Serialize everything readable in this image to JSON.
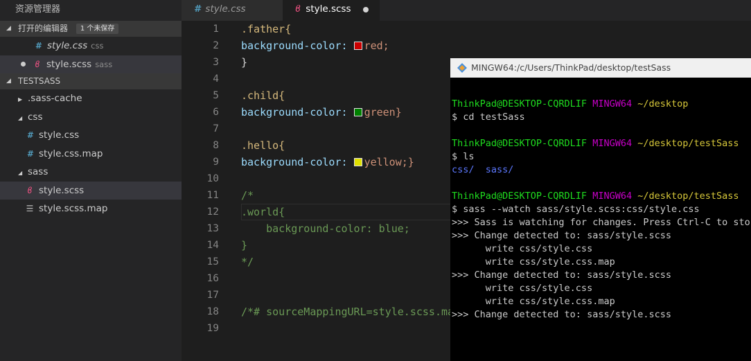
{
  "sidebar": {
    "header": "资源管理器",
    "open_editors": {
      "label": "打开的编辑器",
      "badge": "1 个未保存",
      "items": [
        {
          "name": "style.css",
          "hint": "css",
          "icon": "css-hash-icon"
        },
        {
          "name": "style.scss",
          "hint": "sass",
          "icon": "sass-icon"
        }
      ]
    },
    "project": {
      "label": "TESTSASS",
      "items": [
        {
          "name": ".sass-cache"
        },
        {
          "name": "css"
        },
        {
          "name": "style.css"
        },
        {
          "name": "style.css.map"
        },
        {
          "name": "sass"
        },
        {
          "name": "style.scss"
        },
        {
          "name": "style.scss.map"
        }
      ]
    }
  },
  "tabs": [
    {
      "label": "style.css"
    },
    {
      "label": "style.scss"
    }
  ],
  "editor": {
    "line_numbers": [
      "1",
      "2",
      "3",
      "4",
      "5",
      "6",
      "7",
      "8",
      "9",
      "10",
      "11",
      "12",
      "13",
      "14",
      "15",
      "16",
      "17",
      "18",
      "19"
    ],
    "code": {
      "l1": ".father{",
      "l2_prop": "background-color: ",
      "l2_val": "red;",
      "l2_color": "#cc0000",
      "l3": "}",
      "l5": ".child{",
      "l6_prop": "background-color: ",
      "l6_val": "green}",
      "l6_color": "#008000",
      "l8": ".hello{",
      "l9_prop": "background-color: ",
      "l9_val": "yellow;}",
      "l9_color": "#e0e000",
      "l11": "/*",
      "l12": ".world{",
      "l13": "    background-color: blue;",
      "l14": "}",
      "l15": "*/",
      "l18": "/*# sourceMappingURL=style.scss.map"
    }
  },
  "terminal": {
    "title": "MINGW64:/c/Users/ThinkPad/desktop/testSass",
    "user_host": "ThinkPad@DESKTOP-CQRDLIF",
    "env": "MINGW64",
    "path1": "~/desktop",
    "path2": "~/desktop/testSass",
    "cmd1": "$ cd testSass",
    "cmd2": "$ ls",
    "ls_css": "css/",
    "ls_sass": "sass/",
    "cmd3": "$ sass --watch sass/style.scss:css/style.css",
    "out1": ">>> Sass is watching for changes. Press Ctrl-C to stop.",
    "out2": ">>> Change detected to: sass/style.scss",
    "out3": "      write css/style.css",
    "out4": "      write css/style.css.map",
    "out5": ">>> Change detected to: sass/style.scss",
    "out6": "      write css/style.css",
    "out7": "      write css/style.css.map",
    "out8": ">>> Change detected to: sass/style.scss"
  }
}
